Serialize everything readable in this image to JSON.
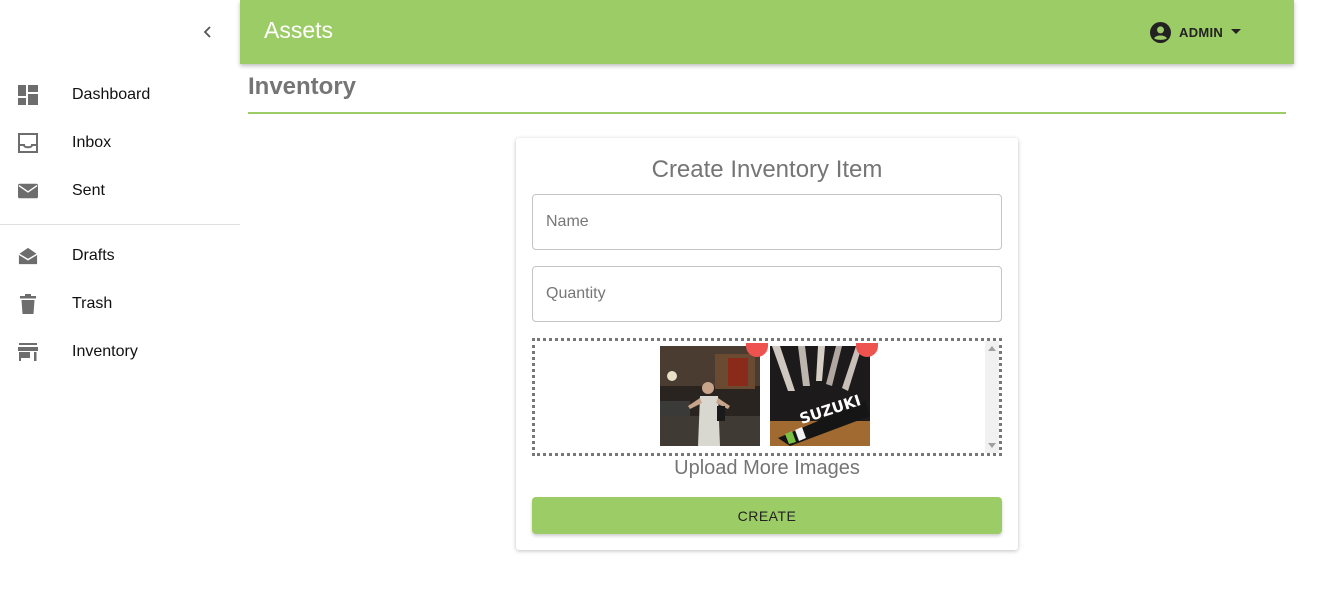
{
  "app": {
    "title": "Assets"
  },
  "user": {
    "name": "ADMIN",
    "icon": "account-circle-icon"
  },
  "sidebar": {
    "primary": [
      {
        "label": "Dashboard",
        "icon": "dashboard-icon"
      },
      {
        "label": "Inbox",
        "icon": "inbox-icon"
      },
      {
        "label": "Sent",
        "icon": "mail-icon"
      }
    ],
    "secondary": [
      {
        "label": "Drafts",
        "icon": "drafts-icon"
      },
      {
        "label": "Trash",
        "icon": "trash-icon"
      },
      {
        "label": "Inventory",
        "icon": "store-icon"
      }
    ]
  },
  "page": {
    "title": "Inventory"
  },
  "form": {
    "title": "Create Inventory Item",
    "name_placeholder": "Name",
    "quantity_placeholder": "Quantity",
    "upload_label": "Upload More Images",
    "submit_label": "CREATE",
    "images": [
      {
        "description": "person-standing-at-night"
      },
      {
        "description": "suzuki-motorcycle-strap"
      }
    ]
  },
  "colors": {
    "accent": "#9ccc65",
    "remove_badge": "#ef5350"
  }
}
